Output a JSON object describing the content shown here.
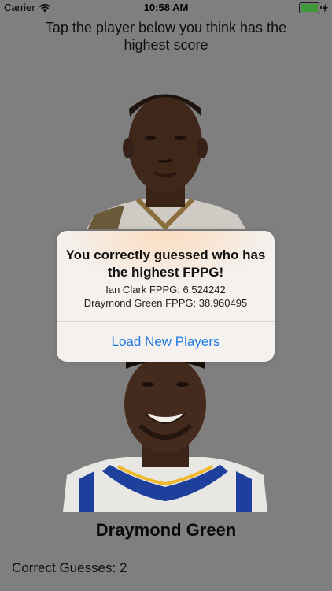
{
  "status_bar": {
    "carrier": "Carrier",
    "time": "10:58 AM",
    "battery_level": 1.0,
    "colors": {
      "battery": "#3e9a3a"
    },
    "icons": [
      "wifi-icon",
      "battery-icon",
      "charging-bolt-icon"
    ]
  },
  "instruction": "Tap the player below you think has the highest score",
  "players": {
    "bottom_name": "Draymond Green"
  },
  "alert": {
    "title": "You correctly guessed who has the highest FPPG!",
    "line1": "Ian Clark FPPG: 6.524242",
    "line2": "Draymond Green FPPG: 38.960495",
    "button": "Load New Players",
    "colors": {
      "button": "#1e7ae0",
      "background": "#f4f1ee"
    }
  },
  "score": {
    "label": "Correct Guesses: 2"
  },
  "colors": {
    "dim_background": "#7f7f7f"
  }
}
